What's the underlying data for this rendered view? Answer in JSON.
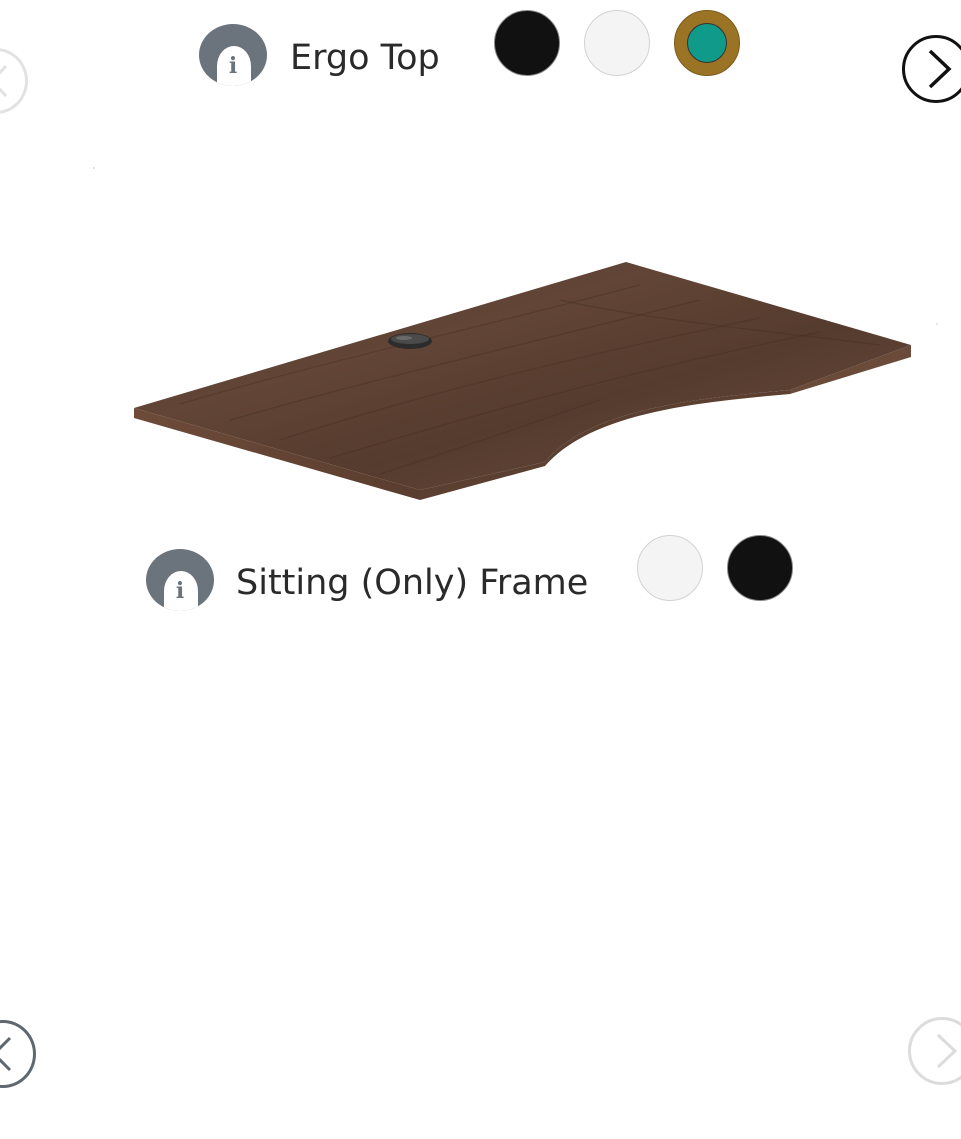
{
  "top_section": {
    "title": "Ergo Top",
    "info_icon": "info-icon",
    "info_glyph": "i",
    "swatches": [
      {
        "name": "black",
        "color": "#111111",
        "selected": false
      },
      {
        "name": "white",
        "color": "#f4f4f4",
        "selected": false
      },
      {
        "name": "walnut",
        "color": "#9a7424",
        "inner_color": "#0f9a8a",
        "selected": true
      }
    ]
  },
  "frame_section": {
    "title": "Sitting (Only) Frame",
    "info_icon": "info-icon",
    "info_glyph": "i",
    "swatches": [
      {
        "name": "white",
        "color": "#f4f4f4",
        "selected": false
      },
      {
        "name": "black",
        "color": "#111111",
        "selected": false
      }
    ]
  },
  "navigation": {
    "top_prev_icon": "chevron-left-icon",
    "top_next_icon": "chevron-right-icon",
    "bottom_prev_icon": "chevron-left-icon",
    "bottom_next_icon": "chevron-right-icon"
  },
  "product_image": {
    "name": "walnut ergo desk top",
    "grommet_icon": "cable-grommet-icon"
  },
  "colors": {
    "wood_top": "#5a3f31",
    "wood_edge": "#6b4b3a",
    "icon_gray": "#6b737d"
  }
}
